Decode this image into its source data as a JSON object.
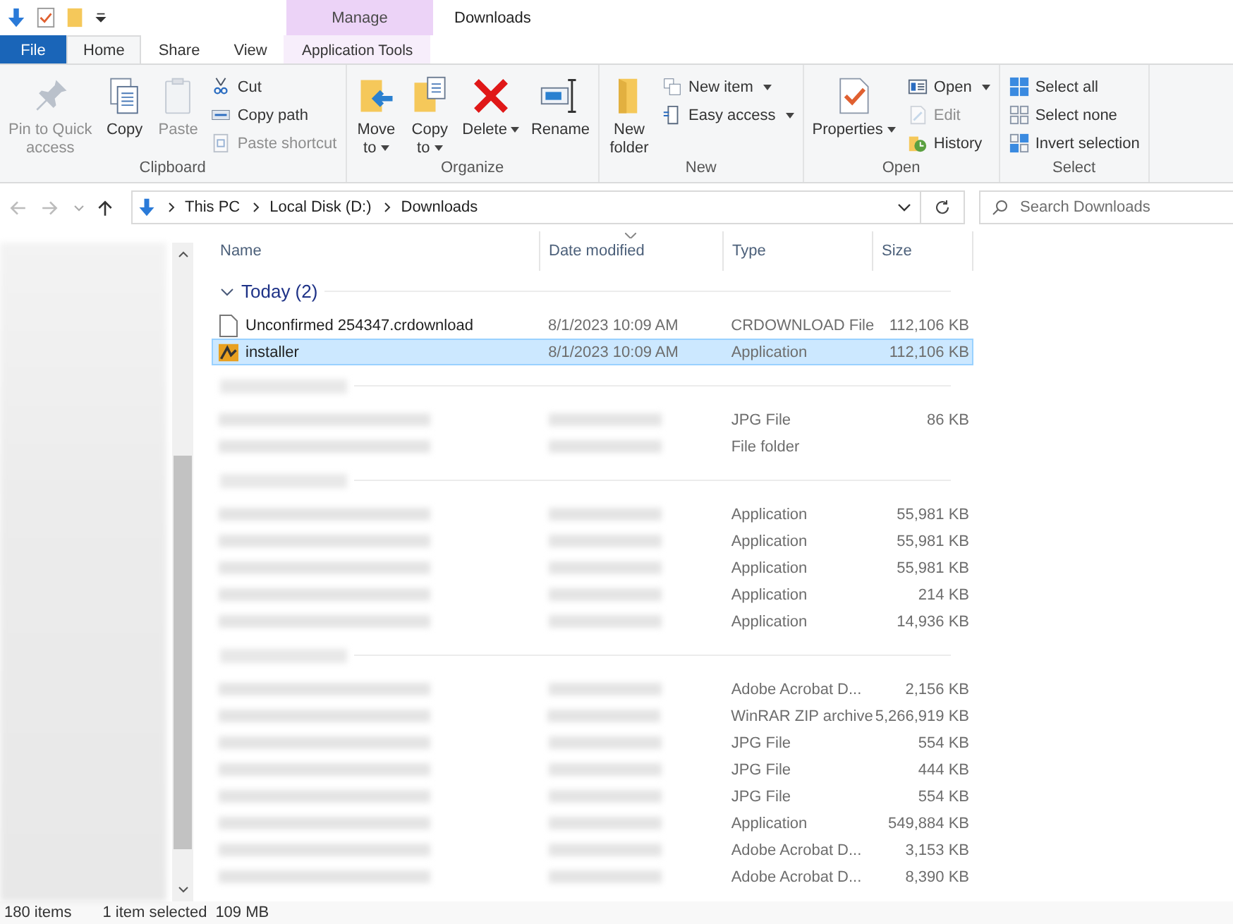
{
  "title_bar": {
    "contextual_tab": "Manage",
    "title": "Downloads"
  },
  "tabs": [
    {
      "label": "File",
      "kind": "file",
      "selected": false
    },
    {
      "label": "Home",
      "kind": "normal",
      "selected": true
    },
    {
      "label": "Share",
      "kind": "normal",
      "selected": false
    },
    {
      "label": "View",
      "kind": "normal",
      "selected": false
    },
    {
      "label": "Application Tools",
      "kind": "contextual",
      "selected": false
    }
  ],
  "ribbon": {
    "groups": [
      {
        "label": "Clipboard",
        "columns": [
          {
            "kind": "large",
            "label": "Pin to Quick\naccess",
            "disabled": true,
            "dropdown": false
          },
          {
            "kind": "large",
            "label": "Copy",
            "disabled": false,
            "dropdown": false
          },
          {
            "kind": "large",
            "label": "Paste",
            "disabled": true,
            "dropdown": false
          },
          {
            "kind": "stack",
            "items": [
              {
                "label": "Cut",
                "disabled": false,
                "dropdown": false
              },
              {
                "label": "Copy path",
                "disabled": false,
                "dropdown": false
              },
              {
                "label": "Paste shortcut",
                "disabled": true,
                "dropdown": false
              }
            ]
          }
        ]
      },
      {
        "label": "Organize",
        "columns": [
          {
            "kind": "large",
            "label": "Move\nto",
            "disabled": false,
            "dropdown": true
          },
          {
            "kind": "large",
            "label": "Copy\nto",
            "disabled": false,
            "dropdown": true
          },
          {
            "kind": "large",
            "label": "Delete",
            "disabled": false,
            "dropdown": true
          },
          {
            "kind": "large",
            "label": "Rename",
            "disabled": false,
            "dropdown": false
          }
        ]
      },
      {
        "label": "New",
        "columns": [
          {
            "kind": "large",
            "label": "New\nfolder",
            "disabled": false,
            "dropdown": false
          },
          {
            "kind": "stack",
            "items": [
              {
                "label": "New item",
                "disabled": false,
                "dropdown": true
              },
              {
                "label": "Easy access",
                "disabled": false,
                "dropdown": true
              }
            ]
          }
        ]
      },
      {
        "label": "Open",
        "columns": [
          {
            "kind": "large",
            "label": "Properties",
            "disabled": false,
            "dropdown": true
          },
          {
            "kind": "stack",
            "items": [
              {
                "label": "Open",
                "disabled": false,
                "dropdown": true
              },
              {
                "label": "Edit",
                "disabled": true,
                "dropdown": false
              },
              {
                "label": "History",
                "disabled": false,
                "dropdown": false
              }
            ]
          }
        ]
      },
      {
        "label": "Select",
        "columns": [
          {
            "kind": "stack",
            "items": [
              {
                "label": "Select all",
                "disabled": false,
                "dropdown": false
              },
              {
                "label": "Select none",
                "disabled": false,
                "dropdown": false
              },
              {
                "label": "Invert selection",
                "disabled": false,
                "dropdown": false
              }
            ]
          }
        ]
      }
    ]
  },
  "address_bar": {
    "back": {
      "disabled": true
    },
    "forward": {
      "disabled": true
    },
    "breadcrumbs": [
      "This PC",
      "Local Disk (D:)",
      "Downloads"
    ]
  },
  "search": {
    "placeholder": "Search Downloads"
  },
  "columns": [
    {
      "label": "Name",
      "sorted": false
    },
    {
      "label": "Date modified",
      "sorted": true
    },
    {
      "label": "Type",
      "sorted": false
    },
    {
      "label": "Size",
      "sorted": false
    }
  ],
  "groups": [
    {
      "title": "Today (2)",
      "rows": [
        {
          "kind": "document",
          "name": "Unconfirmed 254347.crdownload",
          "date": "8/1/2023 10:09 AM",
          "type": "CRDOWNLOAD File",
          "size": "112,106 KB",
          "selected": false
        },
        {
          "kind": "application",
          "name": "installer",
          "date": "8/1/2023 10:09 AM",
          "type": "Application",
          "size": "112,106 KB",
          "selected": true
        }
      ]
    },
    {
      "rows": [
        {
          "kind": "hidden",
          "type": "JPG File",
          "size": "86 KB",
          "selected": false
        },
        {
          "kind": "hidden",
          "type": "File folder",
          "selected": false
        }
      ]
    },
    {
      "rows": [
        {
          "kind": "hidden",
          "type": "Application",
          "size": "55,981 KB",
          "selected": false
        },
        {
          "kind": "hidden",
          "type": "Application",
          "size": "55,981 KB",
          "selected": false
        },
        {
          "kind": "hidden",
          "type": "Application",
          "size": "55,981 KB",
          "selected": false
        },
        {
          "kind": "hidden",
          "type": "Application",
          "size": "214 KB",
          "selected": false
        },
        {
          "kind": "hidden",
          "type": "Application",
          "size": "14,936 KB",
          "selected": false
        }
      ]
    },
    {
      "rows": [
        {
          "kind": "hidden",
          "type": "Adobe Acrobat D...",
          "size": "2,156 KB",
          "selected": false
        },
        {
          "kind": "hidden",
          "type": "WinRAR ZIP archive",
          "size": "5,266,919 KB",
          "selected": false
        },
        {
          "kind": "hidden",
          "type": "JPG File",
          "size": "554 KB",
          "selected": false
        },
        {
          "kind": "hidden",
          "type": "JPG File",
          "size": "444 KB",
          "selected": false
        },
        {
          "kind": "hidden",
          "type": "JPG File",
          "size": "554 KB",
          "selected": false
        },
        {
          "kind": "hidden",
          "type": "Application",
          "size": "549,884 KB",
          "selected": false
        },
        {
          "kind": "hidden",
          "type": "Adobe Acrobat D...",
          "size": "3,153 KB",
          "selected": false
        },
        {
          "kind": "hidden",
          "type": "Adobe Acrobat D...",
          "size": "8,390 KB",
          "selected": false
        }
      ]
    }
  ],
  "status_bar": {
    "item_count": "180 items",
    "selection": "1 item selected",
    "selection_size": "109 MB"
  }
}
